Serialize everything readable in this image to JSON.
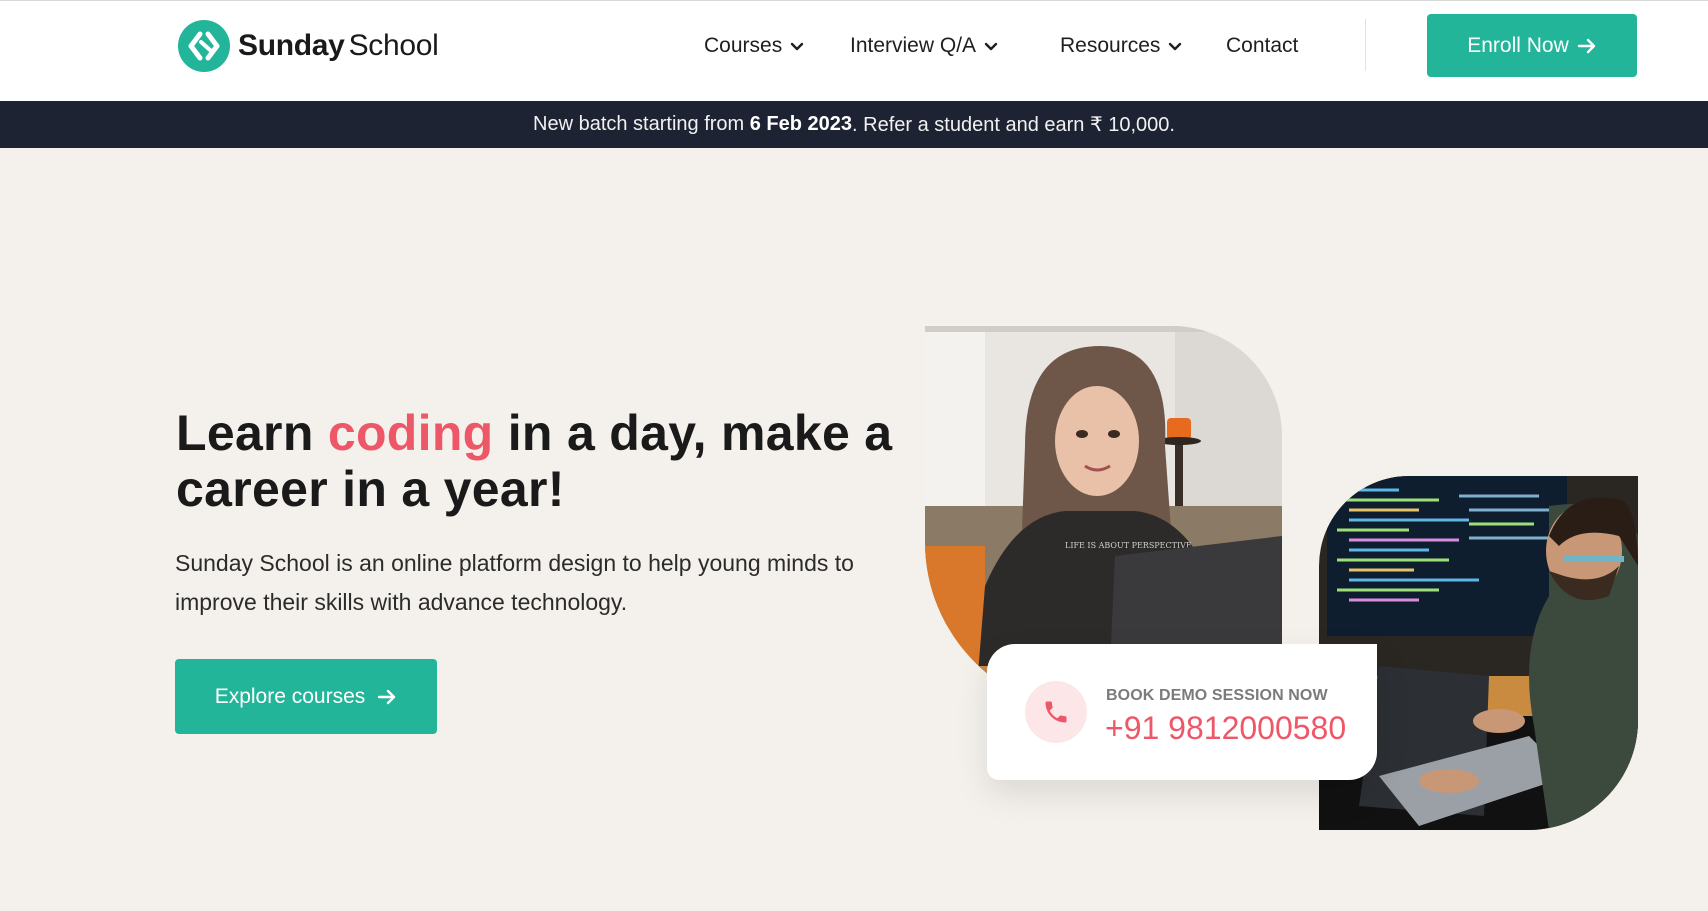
{
  "brand": {
    "name_bold": "Sunday",
    "name_regular": "School",
    "logo_icon": "sunday-school-logo-icon",
    "color": "#22b59a"
  },
  "nav": {
    "items": [
      {
        "label": "Courses",
        "has_dropdown": true
      },
      {
        "label": "Interview Q/A",
        "has_dropdown": true
      },
      {
        "label": "Resources",
        "has_dropdown": true
      },
      {
        "label": "Contact",
        "has_dropdown": false
      }
    ],
    "dropdown_icon": "chevron-down-icon",
    "cta_label": "Enroll Now",
    "cta_icon": "arrow-right-icon"
  },
  "announcement": {
    "prefix": "New batch starting from ",
    "date": "6 Feb 2023",
    "suffix": ". Refer a student and earn ₹ 10,000.",
    "background": "#1e2333"
  },
  "hero": {
    "title_before": "Learn ",
    "title_accent": "coding",
    "title_after": " in a day, make a career in a year!",
    "accent_color": "#ee5767",
    "description": "Sunday School is an online platform design to help young minds to improve their skills with advance technology.",
    "cta_label": "Explore courses",
    "cta_icon": "arrow-right-icon"
  },
  "images": [
    {
      "name": "student-with-laptop-photo"
    },
    {
      "name": "developer-coding-photo"
    }
  ],
  "demo": {
    "label": "BOOK DEMO SESSION NOW",
    "phone": "+91 9812000580",
    "icon": "phone-icon"
  }
}
